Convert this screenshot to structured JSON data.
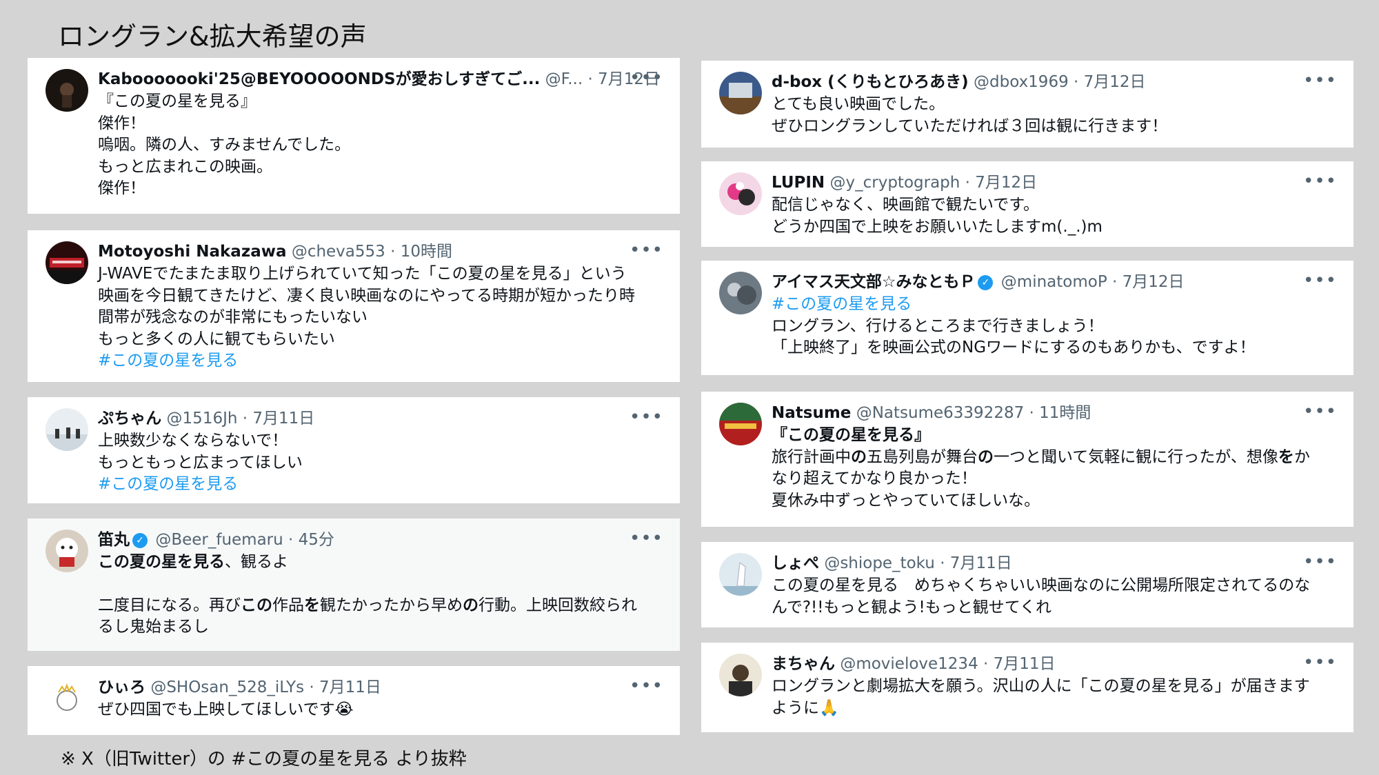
{
  "title": "ロングラン&拡大希望の声",
  "footnote": "※ X（旧Twitter）の #この夏の星を見る より抜粋",
  "more_glyph": "•••",
  "verified_glyph": "✓",
  "left_tweets": [
    {
      "name": "Kabooooooki'25@BEYOOOOONDSが愛おしすぎてご...",
      "handle": "@F...",
      "time": "· 7月12日",
      "lines": [
        "『この夏の星を見る』",
        "傑作！",
        "嗚咽。隣の人、すみませんでした。",
        "もっと広まれこの映画。",
        "傑作！"
      ]
    },
    {
      "name": "Motoyoshi Nakazawa",
      "handle": "@cheva553",
      "time": "· 10時間",
      "lines": [
        "J-WAVEでたまたま取り上げられていて知った「この夏の星を見る」という",
        "映画を今日観てきたけど、凄く良い映画なのにやってる時期が短かったり時",
        "間帯が残念なのが非常にもったいない",
        "もっと多くの人に観てもらいたい"
      ],
      "hashtag": "#この夏の星を見る"
    },
    {
      "name": "ぷちゃん",
      "handle": "@1516Jh",
      "time": "· 7月11日",
      "lines": [
        "上映数少なくならないで！",
        "もっともっと広まってほしい"
      ],
      "hashtag": "#この夏の星を見る"
    },
    {
      "name": "笛丸",
      "handle": "@Beer_fuemaru",
      "time": "· 45分",
      "line1_bold": "この夏の星を見る",
      "line1_rest": "、観るよ",
      "line2": [
        "二度目になる。再び",
        "この",
        "作品",
        "を",
        "観たかったから早め",
        "の",
        "行動。上映回数絞られ"
      ],
      "line3": "るし鬼始まるし"
    },
    {
      "name": "ひぃろ",
      "handle": "@SHOsan_528_iLYs",
      "time": "· 7月11日",
      "lines": [
        "ぜひ四国でも上映してほしいです😭"
      ]
    }
  ],
  "right_tweets": [
    {
      "name": "d-box (くりもとひろあき)",
      "handle": "@dbox1969",
      "time": "· 7月12日",
      "lines": [
        "とても良い映画でした。",
        "ぜひロングランしていただければ３回は観に行きます！"
      ]
    },
    {
      "name": "LUPIN",
      "handle": "@y_cryptograph",
      "time": "· 7月12日",
      "lines": [
        "配信じゃなく、映画館で観たいです。",
        "どうか四国で上映をお願いいたしますm(._.)m"
      ]
    },
    {
      "name": "アイマス天文部☆みなともＰ",
      "handle": "@minatomoP",
      "time": "· 7月12日",
      "hashtag": "#この夏の星を見る",
      "lines": [
        "ロングラン、行けるところまで行きましょう！",
        "「上映終了」を映画公式のNGワードにするのもありかも、ですよ！"
      ]
    },
    {
      "name": "Natsume",
      "handle": "@Natsume63392287",
      "time": "· 11時間",
      "bold_line": "『この夏の星を見る』",
      "line2": [
        "旅行計画中",
        "の",
        "五島列島が舞台",
        "の",
        "一つと聞いて気軽に観に行ったが、想像",
        "を",
        "か"
      ],
      "lines": [
        "なり超えてかなり良かった！",
        "夏休み中ずっとやっていてほしいな。"
      ]
    },
    {
      "name": "しょぺ",
      "handle": "@shiope_toku",
      "time": "· 7月11日",
      "lines": [
        "この夏の星を見る　めちゃくちゃいい映画なのに公開場所限定されてるのな",
        "んで?!!もっと観よう!もっと観せてくれ"
      ]
    },
    {
      "name": "まちゃん",
      "handle": "@movielove1234",
      "time": "· 7月11日",
      "lines": [
        "ロングランと劇場拡大を願う。沢山の人に「この夏の星を見る」が届きます",
        "ように🙏"
      ]
    }
  ]
}
